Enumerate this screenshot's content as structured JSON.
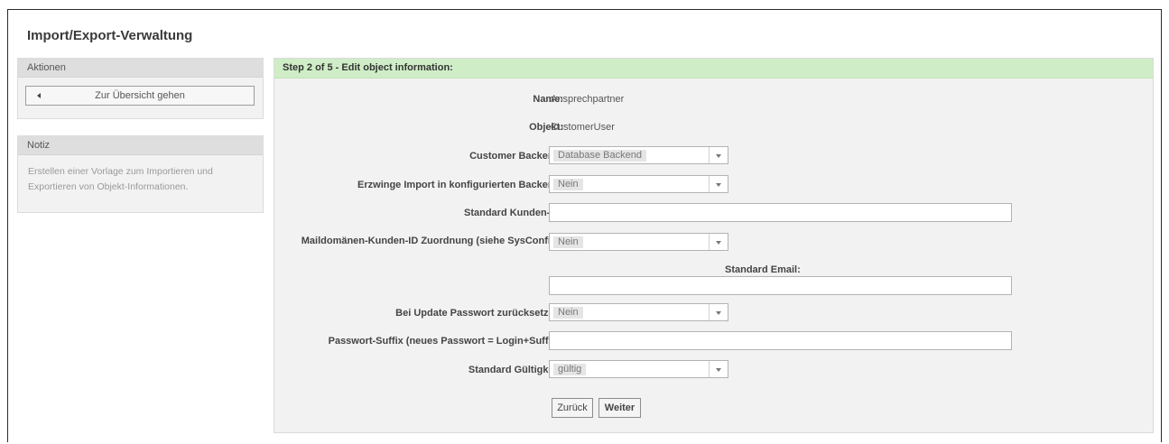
{
  "page": {
    "title": "Import/Export-Verwaltung"
  },
  "sidebar": {
    "actions": {
      "title": "Aktionen",
      "back_label": "Zur Übersicht gehen"
    },
    "note": {
      "title": "Notiz",
      "text_line1": "Erstellen einer Vorlage zum Importieren und",
      "text_line2": "Exportieren von Objekt-Informationen."
    }
  },
  "main": {
    "header": "Step 2 of 5 - Edit object information:",
    "fields": {
      "name": {
        "label": "Name:",
        "value": "Ansprechpartner"
      },
      "object": {
        "label": "Objekt:",
        "value": "CustomerUser"
      },
      "customer_backend": {
        "label": "Customer Backend:",
        "value": "Database Backend"
      },
      "force_import": {
        "label": "Erzwinge Import in konfigurierten Backend:",
        "value": "Nein"
      },
      "default_customer_id": {
        "label": "Standard Kunden-ID:",
        "value": ""
      },
      "maildomain_mapping": {
        "label": "Maildomänen-Kunden-ID Zuordnung (siehe SysConfig):",
        "value": "Nein"
      },
      "default_email": {
        "label": "Standard Email:",
        "value": ""
      },
      "reset_password": {
        "label": "Bei Update Passwort zurücksetzen:",
        "value": "Nein"
      },
      "password_suffix": {
        "label": "Passwort-Suffix (neues Passwort = Login+Suffix):",
        "value": ""
      },
      "default_validity": {
        "label": "Standard Gültigkeit:",
        "value": "gültig"
      }
    },
    "buttons": {
      "back": "Zurück",
      "next": "Weiter"
    }
  }
}
